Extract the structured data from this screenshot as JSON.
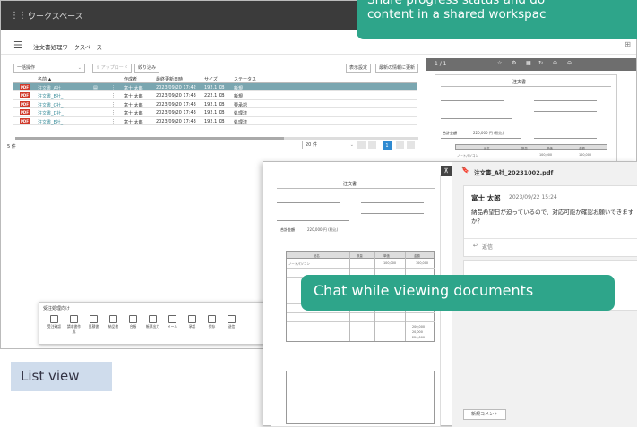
{
  "window": {
    "title": "ワークスペース"
  },
  "header": {
    "title": "注文書処理ワークスペース"
  },
  "toolbar": {
    "bulk": "一括操作",
    "upload": "アップロード",
    "filter": "絞り込み",
    "display": "表示設定",
    "refresh": "最新の情報に更新"
  },
  "table": {
    "columns": [
      "名前 ▲",
      "作成者",
      "最終更新日時",
      "サイズ",
      "ステータス"
    ],
    "rows": [
      {
        "icon": "PDF",
        "name": "注文書_A社_",
        "author": "富士 太郎",
        "updated": "2023/09/20 17:42",
        "size": "192.1 KB",
        "status": "新規"
      },
      {
        "icon": "PDF",
        "name": "注文書_B社_",
        "author": "富士 太郎",
        "updated": "2023/09/20 17:43",
        "size": "222.1 KB",
        "status": "新規"
      },
      {
        "icon": "PDF",
        "name": "注文書_C社_",
        "author": "富士 太郎",
        "updated": "2023/09/20 17:43",
        "size": "192.1 KB",
        "status": "要承認"
      },
      {
        "icon": "PDF",
        "name": "注文書_D社_",
        "author": "富士 太郎",
        "updated": "2023/09/20 17:43",
        "size": "192.1 KB",
        "status": "処理済"
      },
      {
        "icon": "PDF",
        "name": "注文書_E社_",
        "author": "富士 太郎",
        "updated": "2023/09/20 17:43",
        "size": "192.1 KB",
        "status": "処理済"
      }
    ],
    "count": "5 件",
    "page_size": "20 件",
    "page": "1"
  },
  "actions": {
    "title": "受注処理向け",
    "items": [
      "受注確認",
      "請求書作成",
      "見積書",
      "納品書",
      "台帳",
      "帳票出力",
      "メール",
      "承認",
      "保存",
      "送信"
    ]
  },
  "doc": {
    "heading": "注文書",
    "total_label": "合計金額",
    "total_value": "220,000 円 (税込)",
    "subtotal": "200,000",
    "tax": "20,000",
    "grand": "220,000",
    "col_item": "品名",
    "col_qty": "数量",
    "col_price": "単価",
    "col_amount": "金額",
    "row1_item": "ノートパソコン",
    "row1_price": "100,000",
    "row1_amount": "100,000"
  },
  "chat": {
    "file": "注文書_A社_20231002.pdf",
    "author": "富士 太郎",
    "time": "2023/09/22 15:24",
    "message": "納品希望日が迫っているので、対応可能か確認お願いできますか？",
    "reply": "返信",
    "new_comment": "新規コメント"
  },
  "callouts": {
    "top_line1": "Share progress status and do",
    "top_line2": "content in a shared workspac",
    "chat": "Chat while viewing documents",
    "list": "List view"
  },
  "colors": {
    "accent": "#2ea58a",
    "selected_row": "#7aa6b0",
    "topbar": "#3b3b3b"
  }
}
